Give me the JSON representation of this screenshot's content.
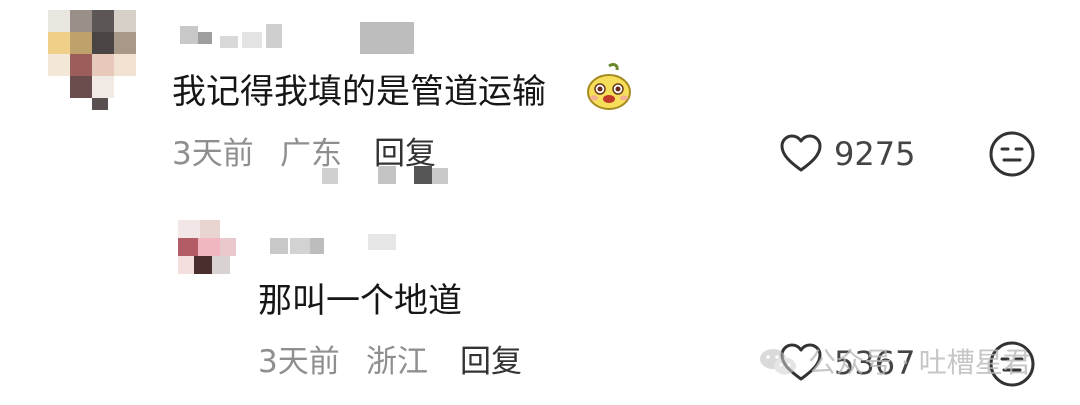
{
  "comments": [
    {
      "text": "我记得我填的是管道运输",
      "emoji": "mango-face-emoji",
      "time": "3天前",
      "location": "广东",
      "reply_label": "回复",
      "like_count": "9275"
    }
  ],
  "replies": [
    {
      "text": "那叫一个地道",
      "time": "3天前",
      "location": "浙江",
      "reply_label": "回复",
      "like_count": "5367"
    }
  ],
  "watermark": {
    "icon": "wechat-icon",
    "text": "公众号 · 吐槽星君"
  },
  "icons": {
    "like": "heart-outline-icon",
    "dislike": "neutral-face-icon"
  }
}
